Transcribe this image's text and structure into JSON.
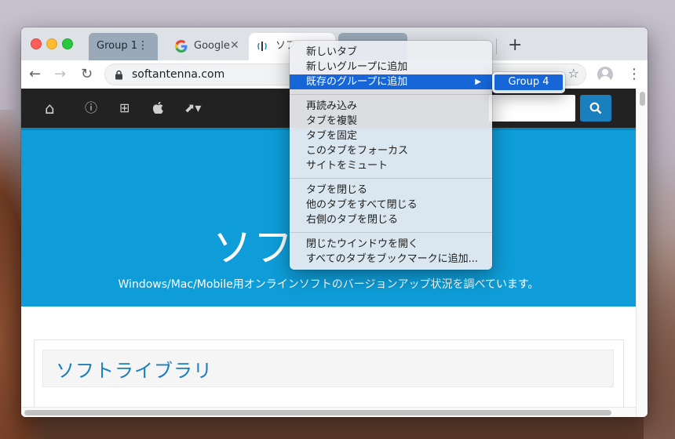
{
  "tabs": {
    "group1_label": "Group 1",
    "group_menu_glyph": "⋮",
    "google_label": "Google",
    "google_close": "✕",
    "active_label": "ソフ",
    "new_tab_glyph": "+"
  },
  "toolbar": {
    "back_glyph": "←",
    "forward_glyph": "→",
    "reload_glyph": "↻",
    "url": "softantenna.com",
    "bookmark_glyph": "☆",
    "menu_glyph": "⋮"
  },
  "site": {
    "hero_title": "ソフ",
    "hero_subtitle": "Windows/Mac/Mobile用オンラインソフトのバージョンアップ状況を調べています。",
    "section_title": "ソフトライブラリ",
    "nav_icons": [
      "home-icon",
      "info-icon",
      "windows-icon",
      "apple-icon",
      "external-link-icon"
    ],
    "nav_glyphs": {
      "home": "⌂",
      "info": "ⓘ",
      "windows": "⊞",
      "apple": "",
      "external": "⬈▾"
    }
  },
  "context_menu": {
    "items": [
      "新しいタブ",
      "新しいグループに追加",
      "既存のグループに追加",
      "再読み込み",
      "タブを複製",
      "タブを固定",
      "このタブをフォーカス",
      "サイトをミュート",
      "タブを閉じる",
      "他のタブをすべて閉じる",
      "右側のタブを閉じる",
      "閉じたウインドウを開く",
      "すべてのタブをブックマークに追加..."
    ],
    "submenu_arrow": "▶",
    "submenu_item": "Group 4"
  },
  "colors": {
    "hero_bg": "#0e9dd8",
    "highlight": "#1666d8",
    "group_chip": "#9aa9b8"
  }
}
